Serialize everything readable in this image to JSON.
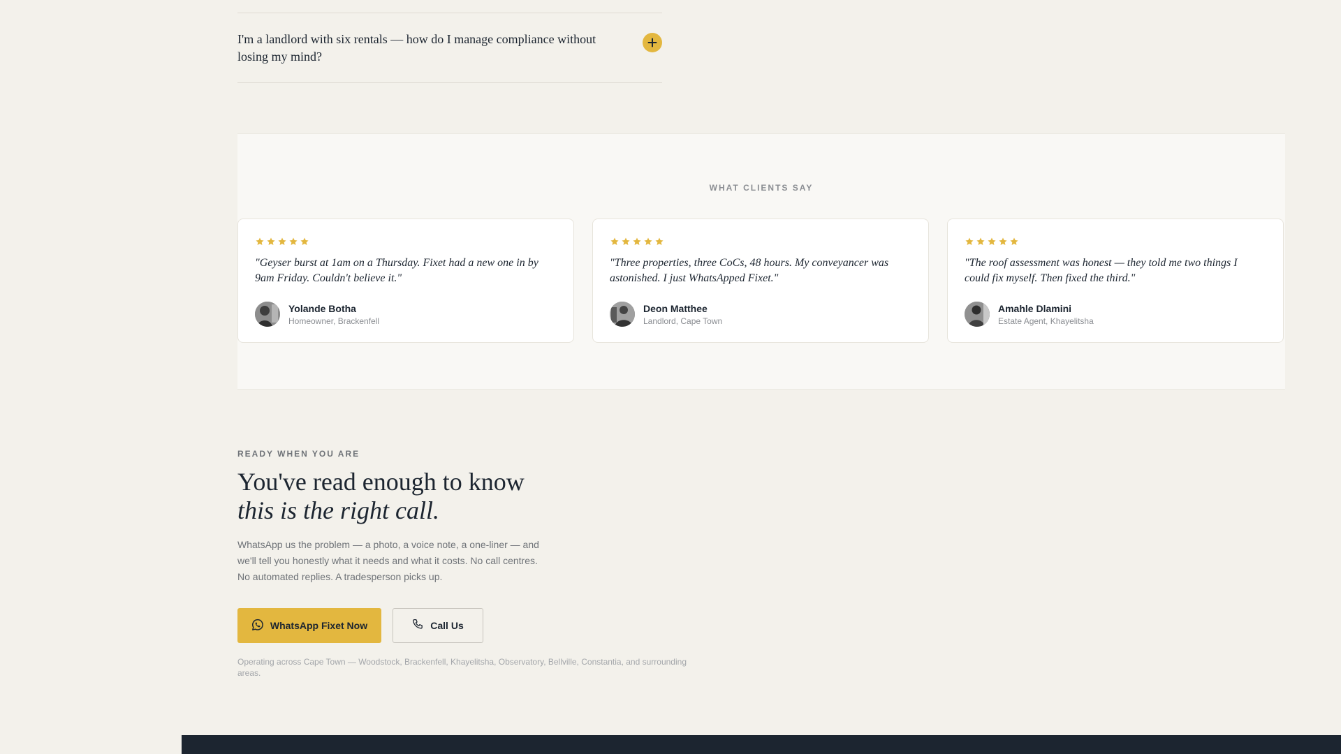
{
  "faq": {
    "items": [
      {
        "question": "I'm a landlord with six rentals — how do I manage compliance without losing my mind?",
        "toggle_icon": "plus-icon"
      }
    ]
  },
  "testimonials": {
    "eyebrow": "WHAT CLIENTS SAY",
    "cards": [
      {
        "rating": 5,
        "quote": "\"Geyser burst at 1am on a Thursday. Fixet had a new one in by 9am Friday. Couldn't believe it.\"",
        "name": "Yolande Botha",
        "role": "Homeowner, Brackenfell"
      },
      {
        "rating": 5,
        "quote": "\"Three properties, three CoCs, 48 hours. My conveyancer was astonished. I just WhatsApped Fixet.\"",
        "name": "Deon Matthee",
        "role": "Landlord, Cape Town"
      },
      {
        "rating": 5,
        "quote": "\"The roof assessment was honest — they told me two things I could fix myself. Then fixed the third.\"",
        "name": "Amahle Dlamini",
        "role": "Estate Agent, Khayelitsha"
      }
    ]
  },
  "cta": {
    "eyebrow": "READY WHEN YOU ARE",
    "heading_line1": "You've read enough to know",
    "heading_line2": "this is the right call.",
    "body": "WhatsApp us the problem — a photo, a voice note, a one-liner — and we'll tell you honestly what it needs and what it costs. No call centres. No automated replies. A tradesperson picks up.",
    "whatsapp_label": "WhatsApp Fixet Now",
    "call_label": "Call Us",
    "coverage": "Operating across Cape Town — Woodstock, Brackenfell, Khayelitsha, Observatory, Bellville, Constantia, and surrounding areas."
  },
  "colors": {
    "accent": "#e3b73f",
    "page_bg": "#f3f1eb",
    "dark": "#1c2530",
    "muted": "#8a8d92"
  }
}
